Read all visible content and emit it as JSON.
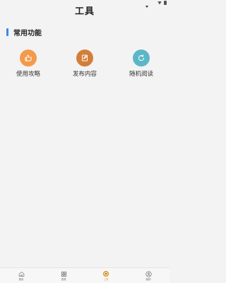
{
  "header": {
    "title": "工具"
  },
  "section": {
    "title": "常用功能"
  },
  "functions": [
    {
      "label": "使用攻略",
      "icon": "thumbs-up-icon",
      "color": "#f39a4c"
    },
    {
      "label": "发布内容",
      "icon": "edit-note-icon",
      "color": "#d27f3a"
    },
    {
      "label": "随机阅读",
      "icon": "refresh-icon",
      "color": "#5bb7c8"
    }
  ],
  "tabs": [
    {
      "label": "首页",
      "icon": "home-icon"
    },
    {
      "label": "发现",
      "icon": "grid-icon"
    },
    {
      "label": "工具",
      "icon": "tool-icon",
      "active": true
    },
    {
      "label": "我的",
      "icon": "user-icon"
    }
  ],
  "colors": {
    "accent": "#2f8cf0",
    "active_tab": "#e8a33a",
    "background": "#f3f3f3"
  }
}
